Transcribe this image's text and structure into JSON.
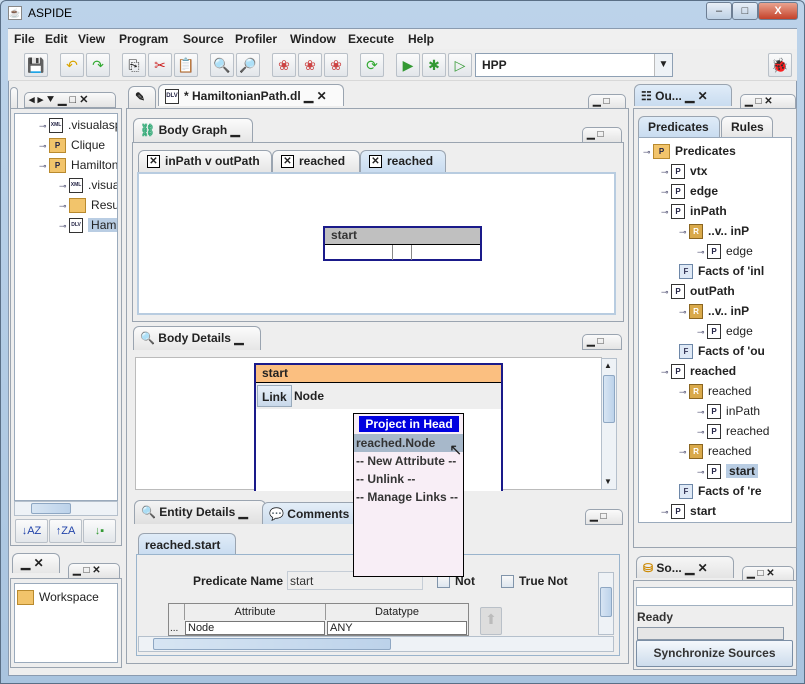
{
  "window": {
    "title": "ASPIDE",
    "min": "–",
    "max": "□",
    "close": "X"
  },
  "menu": [
    "File",
    "Edit",
    "View",
    "Program",
    "Source",
    "Profiler",
    "Window",
    "Execute",
    "Help"
  ],
  "toolbar": {
    "icons": [
      "save-icon",
      "undo-icon",
      "redo-icon",
      "copy-icon",
      "cut-icon",
      "paste-icon",
      "find-icon",
      "find-replace-icon",
      "rule-icon",
      "rules-icon",
      "multi-rule-icon",
      "refresh-icon",
      "run-icon",
      "debug-icon",
      "execute-icon"
    ],
    "config_value": "HPP",
    "plugin_icon": "bug-icon"
  },
  "left": {
    "tree": [
      {
        "label": ".visualasp",
        "depth": 1,
        "icon": "XML",
        "kind": "file"
      },
      {
        "label": "Clique",
        "depth": 1,
        "icon": "P",
        "kind": "folder"
      },
      {
        "label": "Hamiltonia",
        "depth": 1,
        "icon": "P",
        "kind": "folder"
      },
      {
        "label": ".visual",
        "depth": 2,
        "icon": "XML",
        "kind": "file"
      },
      {
        "label": "Result",
        "depth": 2,
        "icon": "",
        "kind": "folder"
      },
      {
        "label": "Hamilt",
        "depth": 2,
        "icon": "DLV",
        "kind": "file",
        "selected": true
      }
    ],
    "workspace": "Workspace"
  },
  "editor": {
    "tab_title": "* HamiltonianPath.dl"
  },
  "body_graph": {
    "title": "Body Graph",
    "tabs": [
      "inPath v outPath",
      "reached",
      "reached"
    ],
    "active_tab": 2,
    "node_label": "start"
  },
  "body_details": {
    "title": "Body Details",
    "predicate": "start",
    "columns": [
      "Link",
      "Node"
    ]
  },
  "popup": {
    "header": "Project in Head",
    "items": [
      "reached.Node",
      "--  New Attribute  --",
      "--  Unlink  --",
      "--  Manage Links  --"
    ],
    "highlighted": 0
  },
  "entity": {
    "title": "Entity Details",
    "comments_tab": "Comments",
    "subtab": "reached.start",
    "predicate_name_label": "Predicate Name",
    "predicate_name": "start",
    "not_label": "Not",
    "true_not_label": "True Not",
    "table_headers": [
      "Attribute",
      "Datatype"
    ],
    "rows": [
      {
        "marker": "...",
        "attribute": "Node",
        "datatype": "ANY"
      }
    ]
  },
  "outline": {
    "tab_title": "Ou...",
    "tabs": [
      "Predicates",
      "Rules"
    ],
    "active_tab": 0,
    "tree": [
      {
        "label": "Predicates",
        "depth": 0,
        "kind": "folder",
        "icon": "P"
      },
      {
        "label": "vtx",
        "depth": 1,
        "kind": "file",
        "icon": "P"
      },
      {
        "label": "edge",
        "depth": 1,
        "kind": "file",
        "icon": "P"
      },
      {
        "label": "inPath",
        "depth": 1,
        "kind": "file",
        "icon": "P"
      },
      {
        "label": "..v.. inP",
        "depth": 2,
        "kind": "rule",
        "icon": "R"
      },
      {
        "label": "edge",
        "depth": 3,
        "kind": "file",
        "icon": "P",
        "normal": true
      },
      {
        "label": "Facts of 'inl",
        "depth": 2,
        "kind": "facts",
        "icon": "F"
      },
      {
        "label": "outPath",
        "depth": 1,
        "kind": "file",
        "icon": "P"
      },
      {
        "label": "..v.. inP",
        "depth": 2,
        "kind": "rule",
        "icon": "R"
      },
      {
        "label": "edge",
        "depth": 3,
        "kind": "file",
        "icon": "P",
        "normal": true
      },
      {
        "label": "Facts of 'ou",
        "depth": 2,
        "kind": "facts",
        "icon": "F"
      },
      {
        "label": "reached",
        "depth": 1,
        "kind": "file",
        "icon": "P"
      },
      {
        "label": "reached",
        "depth": 2,
        "kind": "rule",
        "icon": "R",
        "normal": true
      },
      {
        "label": "inPath",
        "depth": 3,
        "kind": "file",
        "icon": "P",
        "normal": true
      },
      {
        "label": "reached",
        "depth": 3,
        "kind": "file",
        "icon": "P",
        "normal": true
      },
      {
        "label": "reached",
        "depth": 2,
        "kind": "rule",
        "icon": "R",
        "normal": true
      },
      {
        "label": "start",
        "depth": 3,
        "kind": "file",
        "icon": "P",
        "selected": true
      },
      {
        "label": "Facts of 're",
        "depth": 2,
        "kind": "facts",
        "icon": "F"
      },
      {
        "label": "start",
        "depth": 1,
        "kind": "file",
        "icon": "P"
      }
    ]
  },
  "sources": {
    "tab_title": "So...",
    "status": "Ready",
    "sync_button": "Synchronize Sources"
  }
}
